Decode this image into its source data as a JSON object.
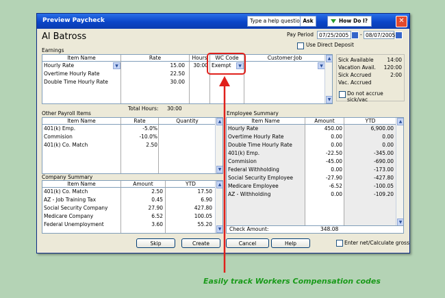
{
  "window": {
    "title": "Preview Paycheck",
    "help_placeholder": "Type a help question",
    "ask_label": "Ask",
    "howdoi_label": "How Do I?",
    "close_icon": "close-icon"
  },
  "employee": {
    "name": "Al Batross"
  },
  "pay_period": {
    "label": "Pay Period",
    "start": "07/25/2005",
    "separator": "-",
    "end": "08/07/2005"
  },
  "direct_deposit": {
    "label": "Use Direct Deposit",
    "checked": false
  },
  "earnings": {
    "section_label": "Earnings",
    "headers": [
      "Item Name",
      "Rate",
      "Hours",
      "WC Code",
      "Customer:Job"
    ],
    "rows": [
      {
        "item": "Hourly Rate",
        "rate": "15.00",
        "hours": "30:00",
        "wc": "Exempt"
      },
      {
        "item": "Overtime Hourly Rate",
        "rate": "22.50",
        "hours": "",
        "wc": ""
      },
      {
        "item": "Double Time Hourly Rate",
        "rate": "30.00",
        "hours": "",
        "wc": ""
      }
    ],
    "total_label": "Total Hours:",
    "total_value": "30:00"
  },
  "sick_vac": [
    {
      "label": "Sick Available",
      "value": "14:00"
    },
    {
      "label": "Vacation Avail.",
      "value": "120:00"
    },
    {
      "label": "Sick Accrued",
      "value": "2:00"
    },
    {
      "label": "Vac. Accrued",
      "value": ""
    }
  ],
  "no_accrue": {
    "label": "Do not accrue sick/vac",
    "checked": false
  },
  "other_payroll": {
    "section_label": "Other Payroll Items",
    "headers": [
      "Item Name",
      "Rate",
      "Quantity"
    ],
    "rows": [
      {
        "item": "401(k) Emp.",
        "rate": "-5.0%",
        "qty": ""
      },
      {
        "item": "Commision",
        "rate": "-10.0%",
        "qty": ""
      },
      {
        "item": "401(k) Co. Match",
        "rate": "2.50",
        "qty": ""
      }
    ]
  },
  "employee_summary": {
    "section_label": "Employee Summary",
    "headers": [
      "Item Name",
      "Amount",
      "YTD"
    ],
    "rows": [
      {
        "item": "Hourly Rate",
        "amount": "450.00",
        "ytd": "6,900.00"
      },
      {
        "item": "Overtime Hourly Rate",
        "amount": "0.00",
        "ytd": "0.00"
      },
      {
        "item": "Double Time Hourly Rate",
        "amount": "0.00",
        "ytd": "0.00"
      },
      {
        "item": "401(k) Emp.",
        "amount": "-22.50",
        "ytd": "-345.00"
      },
      {
        "item": "Commision",
        "amount": "-45.00",
        "ytd": "-690.00"
      },
      {
        "item": "Federal Withholding",
        "amount": "0.00",
        "ytd": "-173.00"
      },
      {
        "item": "Social Security Employee",
        "amount": "-27.90",
        "ytd": "-427.80"
      },
      {
        "item": "Medicare Employee",
        "amount": "-6.52",
        "ytd": "-100.05"
      },
      {
        "item": "AZ - Withholding",
        "amount": "0.00",
        "ytd": "-109.20"
      }
    ],
    "check_label": "Check Amount:",
    "check_value": "348.08"
  },
  "company_summary": {
    "section_label": "Company Summary",
    "headers": [
      "Item Name",
      "Amount",
      "YTD"
    ],
    "rows": [
      {
        "item": "401(k) Co. Match",
        "amount": "2.50",
        "ytd": "17.50"
      },
      {
        "item": "AZ - Job Training Tax",
        "amount": "0.45",
        "ytd": "6.90"
      },
      {
        "item": "Social Security Company",
        "amount": "27.90",
        "ytd": "427.80"
      },
      {
        "item": "Medicare Company",
        "amount": "6.52",
        "ytd": "100.05"
      },
      {
        "item": "Federal Unemployment",
        "amount": "3.60",
        "ytd": "55.20"
      }
    ]
  },
  "buttons": {
    "skip": "Skip",
    "create": "Create",
    "cancel": "Cancel",
    "help": "Help"
  },
  "enter_net": {
    "label": "Enter net/Calculate gross",
    "checked": false
  },
  "caption": "Easily track Workers Compensation codes",
  "colors": {
    "highlight": "#e0201b",
    "caption": "#1a9a1a",
    "title_bar": "#0a45c8",
    "background": "#b4d3b5"
  }
}
